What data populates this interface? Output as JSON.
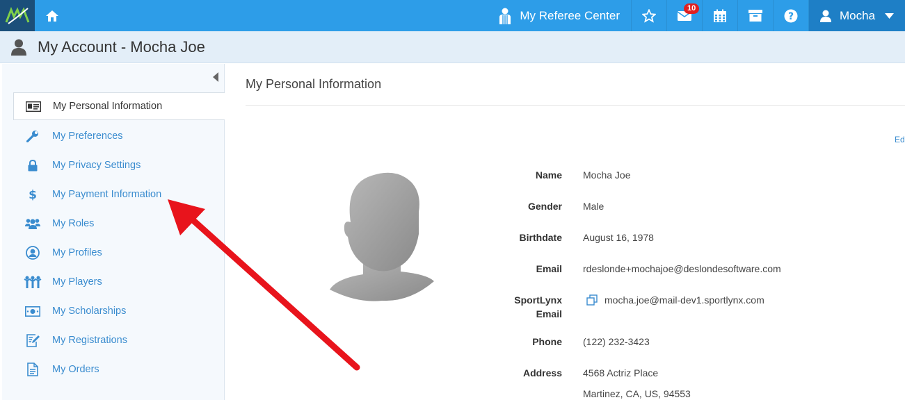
{
  "header": {
    "referee_center_label": "My Referee Center",
    "messages_badge": "10",
    "user_name": "Mocha",
    "icons": [
      "logo-icon",
      "home-icon",
      "referee-icon",
      "star-icon",
      "mail-icon",
      "calendar-icon",
      "archive-icon",
      "help-icon",
      "user-icon",
      "caret-down-icon"
    ]
  },
  "page": {
    "title": "My Account - Mocha Joe"
  },
  "sidebar": {
    "items": [
      {
        "label": "My Personal Information",
        "icon": "id-card-icon",
        "active": true
      },
      {
        "label": "My Preferences",
        "icon": "wrench-icon"
      },
      {
        "label": "My Privacy Settings",
        "icon": "lock-icon"
      },
      {
        "label": "My Payment Information",
        "icon": "dollar-icon"
      },
      {
        "label": "My Roles",
        "icon": "users-icon"
      },
      {
        "label": "My Profiles",
        "icon": "profile-icon"
      },
      {
        "label": "My Players",
        "icon": "players-icon"
      },
      {
        "label": "My Scholarships",
        "icon": "money-icon"
      },
      {
        "label": "My Registrations",
        "icon": "edit-doc-icon"
      },
      {
        "label": "My Orders",
        "icon": "document-icon"
      }
    ]
  },
  "content": {
    "section_title": "My Personal Information",
    "edit_link": "Ed",
    "fields": {
      "name_label": "Name",
      "name_value": "Mocha Joe",
      "gender_label": "Gender",
      "gender_value": "Male",
      "birthdate_label": "Birthdate",
      "birthdate_value": "August 16, 1978",
      "email_label": "Email",
      "email_value": "rdeslonde+mochajoe@deslondesoftware.com",
      "sportlynx_label_1": "SportLynx",
      "sportlynx_label_2": "Email",
      "sportlynx_value": "mocha.joe@mail-dev1.sportlynx.com",
      "phone_label": "Phone",
      "phone_value": "(122) 232-3423",
      "address_label": "Address",
      "address_line1": "4568 Actriz Place",
      "address_line2": "Martinez, CA, US, 94553"
    }
  },
  "colors": {
    "topbar": "#2d9de8",
    "user_menu": "#1e7fc6",
    "link": "#3a8ccf",
    "badge": "#e02020",
    "annotation_arrow": "#e8141c"
  }
}
